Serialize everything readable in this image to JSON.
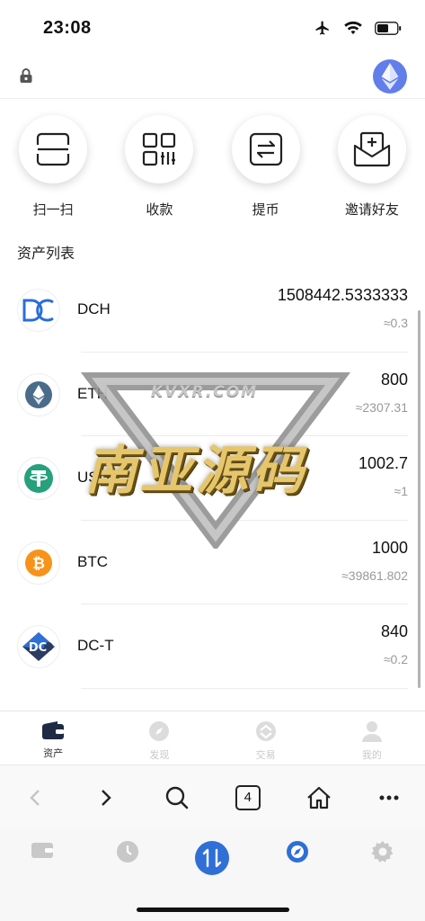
{
  "status_bar": {
    "time": "23:08"
  },
  "quick_actions": [
    {
      "label": "扫一扫",
      "icon": "scan-icon"
    },
    {
      "label": "收款",
      "icon": "qr-code-icon"
    },
    {
      "label": "提币",
      "icon": "transfer-icon"
    },
    {
      "label": "邀请好友",
      "icon": "invite-envelope-icon"
    }
  ],
  "asset_list_title": "资产列表",
  "assets": [
    {
      "symbol": "DCH",
      "amount": "1508442.5333333",
      "fiat": "≈0.3",
      "icon": "dch-logo-icon"
    },
    {
      "symbol": "ETH",
      "amount": "800",
      "fiat": "≈2307.31",
      "icon": "eth-logo-icon"
    },
    {
      "symbol": "USDT",
      "amount": "1002.7",
      "fiat": "≈1",
      "icon": "usdt-logo-icon"
    },
    {
      "symbol": "BTC",
      "amount": "1000",
      "fiat": "≈39861.802",
      "icon": "btc-logo-icon"
    },
    {
      "symbol": "DC-T",
      "amount": "840",
      "fiat": "≈0.2",
      "icon": "dct-logo-icon"
    }
  ],
  "watermark": {
    "site": "KVXR.COM",
    "text": "南亚源码"
  },
  "tabbar": [
    {
      "label": "资产",
      "icon": "wallet-icon",
      "active": true
    },
    {
      "label": "发现",
      "icon": "compass-icon",
      "active": false
    },
    {
      "label": "交易",
      "icon": "trade-icon",
      "active": false
    },
    {
      "label": "我的",
      "icon": "profile-icon",
      "active": false
    }
  ],
  "browser": {
    "tab_count": "4"
  },
  "colors": {
    "brand_blue": "#2f6fd6",
    "eth_purple": "#627eea",
    "usdt_green": "#26a17b",
    "btc_orange": "#f7931a"
  }
}
